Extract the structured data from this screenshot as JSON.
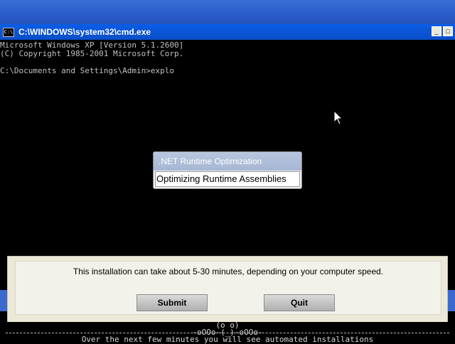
{
  "cmd": {
    "title": "C:\\WINDOWS\\system32\\cmd.exe",
    "icon_text": "C:\\",
    "minimize": "_",
    "maximize": "□",
    "lines": [
      "Microsoft Windows XP [Version 5.1.2600]",
      "(C) Copyright 1985-2001 Microsoft Corp.",
      "",
      "C:\\Documents and Settings\\Admin>explo"
    ]
  },
  "popup": {
    "title": ".NET Runtime Optimization",
    "message": "Optimizing Runtime Assemblies"
  },
  "installer": {
    "message": "This installation can take about 5-30 minutes, depending on your computer speed.",
    "submit_label": "Submit",
    "quit_label": "Quit"
  },
  "console_bottom": {
    "face": "(o o)",
    "ascii": "-oOOo-(_)-oOOo-",
    "text": "Over the next few minutes you will see automated installations"
  }
}
